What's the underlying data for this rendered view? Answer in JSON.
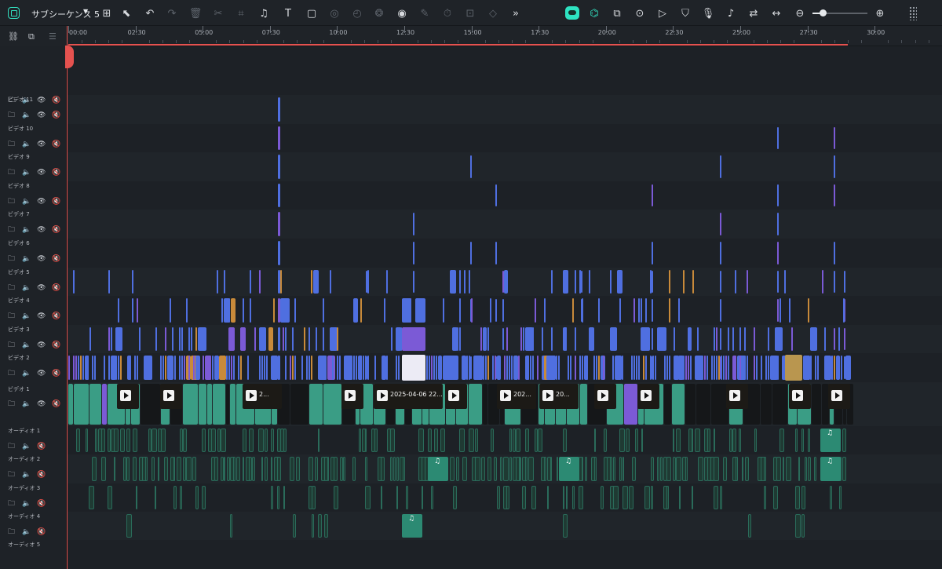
{
  "toolbar": {
    "sequence_title": "サブシーケンス 5",
    "left_icons": [
      "grid-icon",
      "select-icon",
      "undo-icon",
      "redo-icon",
      "delete-icon",
      "cut-icon",
      "crop-icon",
      "audio-icon",
      "text-icon",
      "shape-icon",
      "color-icon",
      "speed-icon",
      "mask-icon",
      "ai-icon",
      "edit-icon",
      "timer-icon",
      "freeze-icon",
      "keyframe-icon",
      "more-icon"
    ],
    "right_icons": [
      "ai-assistant-icon",
      "snap-icon",
      "auto-icon",
      "record-icon",
      "play-icon",
      "shield-icon",
      "mic-icon",
      "music-list-icon",
      "replace-icon",
      "fit-icon",
      "zoom-out-icon",
      "zoom-in-icon"
    ]
  },
  "ruler": {
    "labels": [
      "00:00",
      "02:30",
      "05:00",
      "07:30",
      "10:00",
      "12:30",
      "15:00",
      "17:30",
      "20:00",
      "22:30",
      "25:00",
      "27:30",
      "30:00"
    ]
  },
  "tracks": {
    "video": [
      "ビデオ 11",
      "ビデオ 10",
      "ビデオ 9",
      "ビデオ 8",
      "ビデオ 7",
      "ビデオ 6",
      "ビデオ 5",
      "ビデオ 4",
      "ビデオ 3",
      "ビデオ 2",
      "ビデオ 1"
    ],
    "audio": [
      "オーディオ 1",
      "オーディオ 2",
      "オーディオ 3",
      "オーディオ 4",
      "オーディオ 5"
    ]
  },
  "clips": {
    "video1_labels": [
      "2...",
      "2025-04-06 22...",
      "202...",
      "20..."
    ]
  },
  "colors": {
    "accent": "#33e0c0",
    "playhead": "#e5524f",
    "video_clip": "#4f6fe0",
    "audio_clip": "#2fa88a"
  }
}
